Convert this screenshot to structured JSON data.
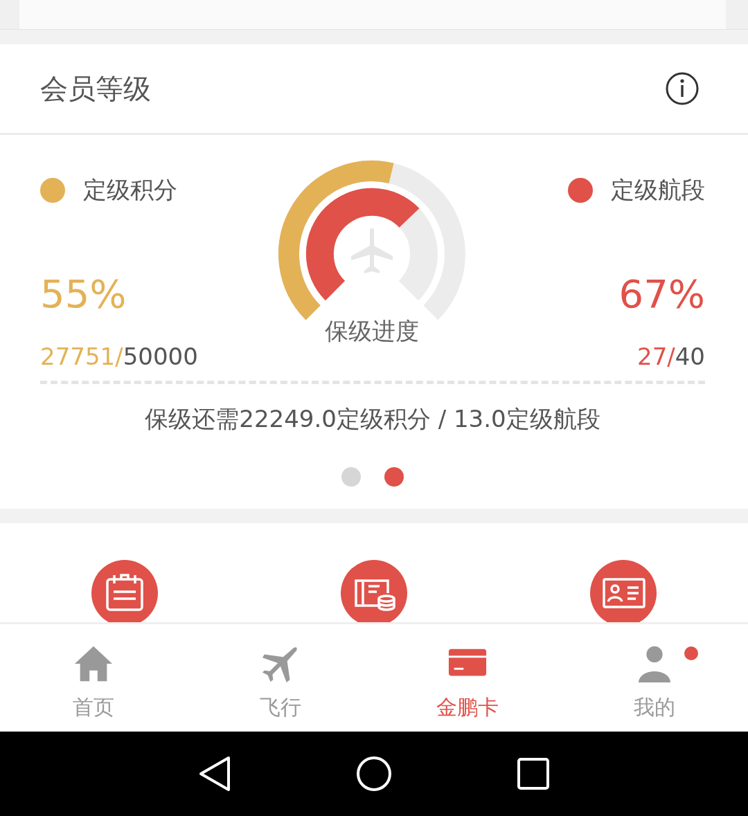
{
  "member_level": {
    "title": "会员等级",
    "points": {
      "label": "定级积分",
      "color": "#e3b257",
      "percent": "55%",
      "current": "27751",
      "separator": "/",
      "target": "50000"
    },
    "segments": {
      "label": "定级航段",
      "color": "#e05149",
      "percent": "67%",
      "current": "27",
      "separator": "/",
      "target": "40"
    },
    "gauge_label": "保级进度",
    "summary": "保级还需22249.0定级积分 / 13.0定级航段",
    "pager": [
      {
        "selected": false
      },
      {
        "selected": true
      }
    ]
  },
  "tabs": [
    {
      "label": "首页",
      "selected": false,
      "badge": false
    },
    {
      "label": "飞行",
      "selected": false,
      "badge": false
    },
    {
      "label": "金鹏卡",
      "selected": true,
      "badge": false
    },
    {
      "label": "我的",
      "selected": false,
      "badge": true
    }
  ]
}
